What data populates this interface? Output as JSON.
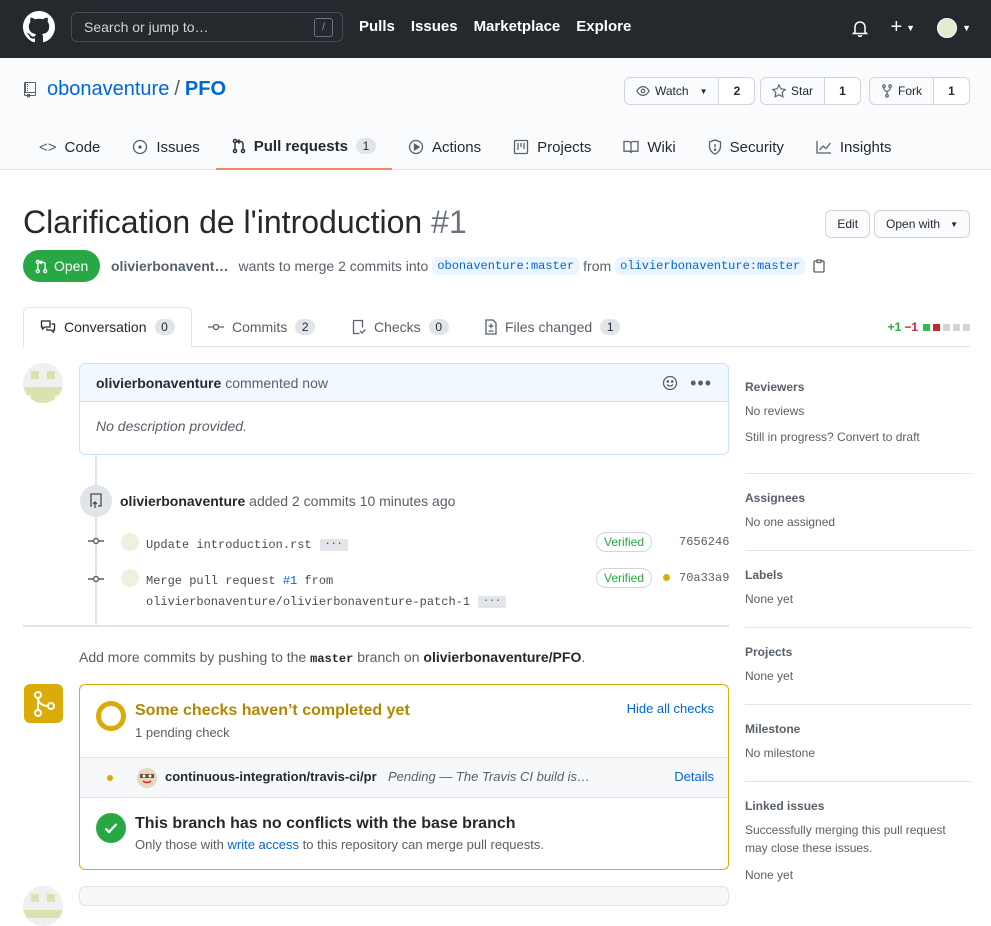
{
  "header": {
    "search_placeholder": "Search or jump to…",
    "search_shortcut": "/",
    "nav": [
      "Pulls",
      "Issues",
      "Marketplace",
      "Explore"
    ],
    "plus_label": "+"
  },
  "repo": {
    "owner": "obonaventure",
    "separator": "/",
    "name": "PFO",
    "watch_label": "Watch",
    "watch_count": "2",
    "star_label": "Star",
    "star_count": "1",
    "fork_label": "Fork",
    "fork_count": "1"
  },
  "reponav": {
    "code": "Code",
    "issues": "Issues",
    "pulls": "Pull requests",
    "pulls_count": "1",
    "actions": "Actions",
    "projects": "Projects",
    "wiki": "Wiki",
    "security": "Security",
    "insights": "Insights"
  },
  "pr": {
    "title": "Clarification de l'introduction",
    "number": "#1",
    "edit_label": "Edit",
    "open_with_label": "Open with",
    "state": "Open",
    "author": "olivierbonavent…",
    "merge_text": "wants to merge 2 commits into",
    "base_ref": "obonaventure:master",
    "from_text": "from",
    "head_ref": "olivierbonaventure:master"
  },
  "tabs": {
    "conversation": "Conversation",
    "conversation_count": "0",
    "commits": "Commits",
    "commits_count": "2",
    "checks": "Checks",
    "checks_count": "0",
    "files": "Files changed",
    "files_count": "1",
    "additions": "+1",
    "deletions": "−1"
  },
  "comment": {
    "author": "olivierbonaventure",
    "action": "commented now",
    "body": "No description provided."
  },
  "event": {
    "actor": "olivierbonaventure",
    "text_added": "added",
    "text_count": "2 commits",
    "time": "10 minutes ago"
  },
  "commits": [
    {
      "message": "Update introduction.rst",
      "verified": "Verified",
      "sha": "7656246"
    },
    {
      "message_pre": "Merge pull request ",
      "message_link": "#1",
      "message_post": " from",
      "message_line2": "olivierbonaventure/olivierbonaventure-patch-1",
      "verified": "Verified",
      "sha": "70a33a9"
    }
  ],
  "addmore": {
    "pre": "Add more commits by pushing to the",
    "branch": "master",
    "mid": "branch on",
    "repo": "olivierbonaventure/PFO",
    "end": "."
  },
  "checks": {
    "title": "Some checks haven’t completed yet",
    "subtitle": "1 pending check",
    "hide_label": "Hide all checks",
    "check_name": "continuous-integration/travis-ci/pr",
    "check_status": "Pending — The Travis CI build is…",
    "details_label": "Details",
    "ok_title": "This branch has no conflicts with the base branch",
    "ok_sub_pre": "Only those with",
    "ok_sub_link": "write access",
    "ok_sub_post": "to this repository can merge pull requests."
  },
  "sidebar": {
    "reviewers_h": "Reviewers",
    "reviewers_v": "No reviews",
    "reviewers_draft": "Still in progress? Convert to draft",
    "assignees_h": "Assignees",
    "assignees_v": "No one assigned",
    "labels_h": "Labels",
    "labels_v": "None yet",
    "projects_h": "Projects",
    "projects_v": "None yet",
    "milestone_h": "Milestone",
    "milestone_v": "No milestone",
    "linked_h": "Linked issues",
    "linked_v": "Successfully merging this pull request may close these issues.",
    "linked_v2": "None yet"
  },
  "colors": {
    "accent": "#0366d6",
    "open": "#28a745",
    "pending": "#dbab09",
    "header_bg": "#24292e",
    "tab_underline": "#f9826c"
  }
}
